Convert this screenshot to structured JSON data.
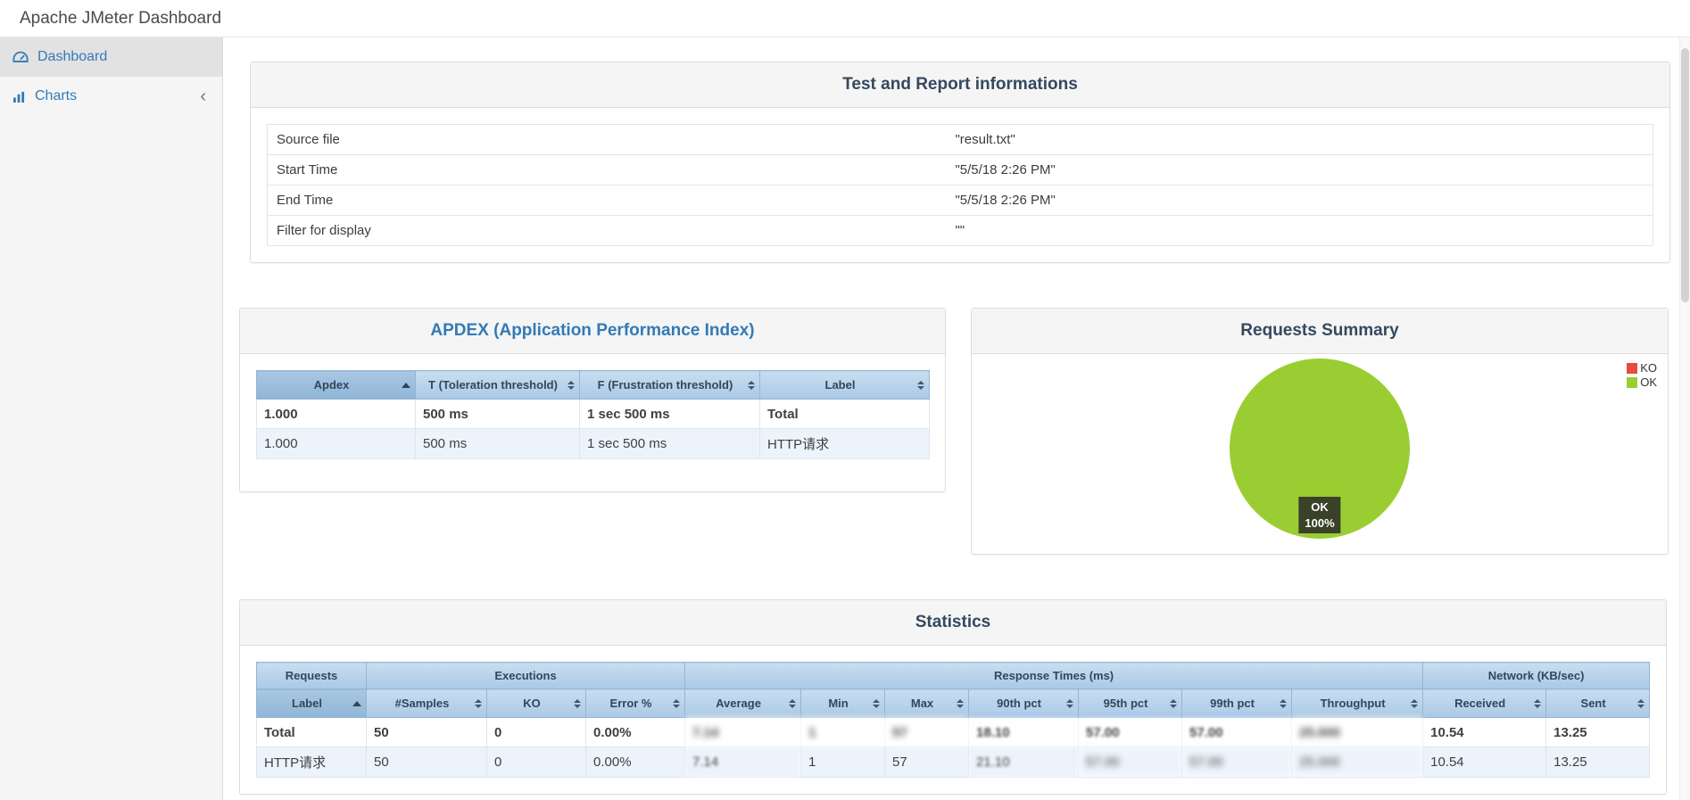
{
  "colors": {
    "accent-blue": "#337ab7",
    "title-dark": "#34495e",
    "sidebar-bg": "#f5f5f5",
    "panel-head-bg": "#f5f5f5",
    "ok-green": "#9acd32",
    "ko-red": "#e74c3c"
  },
  "app": {
    "title": "Apache JMeter Dashboard"
  },
  "sidebar": {
    "items": [
      {
        "label": "Dashboard",
        "active": true
      },
      {
        "label": "Charts",
        "active": false
      }
    ],
    "collapse_glyph": "‹"
  },
  "info_panel": {
    "title": "Test and Report informations",
    "rows": [
      {
        "label": "Source file",
        "value": "\"result.txt\""
      },
      {
        "label": "Start Time",
        "value": "\"5/5/18 2:26 PM\""
      },
      {
        "label": "End Time",
        "value": "\"5/5/18 2:26 PM\""
      },
      {
        "label": "Filter for display",
        "value": "\"\""
      }
    ]
  },
  "apdex": {
    "title": "APDEX (Application Performance Index)",
    "headers": [
      "Apdex",
      "T (Toleration threshold)",
      "F (Frustration threshold)",
      "Label"
    ],
    "rows": [
      [
        "1.000",
        "500 ms",
        "1 sec 500 ms",
        "Total"
      ],
      [
        "1.000",
        "500 ms",
        "1 sec 500 ms",
        "HTTP请求"
      ]
    ]
  },
  "requests_summary": {
    "title": "Requests Summary",
    "legend": [
      {
        "label": "KO",
        "color": "#e74c3c"
      },
      {
        "label": "OK",
        "color": "#9acd32"
      }
    ],
    "slice_label": {
      "line1": "OK",
      "line2": "100%"
    }
  },
  "chart_data": {
    "type": "pie",
    "title": "Requests Summary",
    "labels": [
      "OK",
      "KO"
    ],
    "values": [
      100,
      0
    ],
    "unit": "%",
    "colors": {
      "OK": "#9acd32",
      "KO": "#e74c3c"
    },
    "legend_position": "top-right",
    "data_labels": [
      "OK 100%"
    ]
  },
  "statistics": {
    "title": "Statistics",
    "groups": [
      "Requests",
      "Executions",
      "Response Times (ms)",
      "Network (KB/sec)"
    ],
    "headers": [
      "Label",
      "#Samples",
      "KO",
      "Error %",
      "Average",
      "Min",
      "Max",
      "90th pct",
      "95th pct",
      "99th pct",
      "Throughput",
      "Received",
      "Sent"
    ],
    "rows": [
      [
        "Total",
        "50",
        "0",
        "0.00%",
        "7.14",
        "1",
        "57",
        "18.10",
        "57.00",
        "57.00",
        "25.000",
        "10.54",
        "13.25"
      ],
      [
        "HTTP请求",
        "50",
        "0",
        "0.00%",
        "7.14",
        "1",
        "57",
        "21.10",
        "57.00",
        "57.00",
        "25.000",
        "10.54",
        "13.25"
      ]
    ]
  }
}
